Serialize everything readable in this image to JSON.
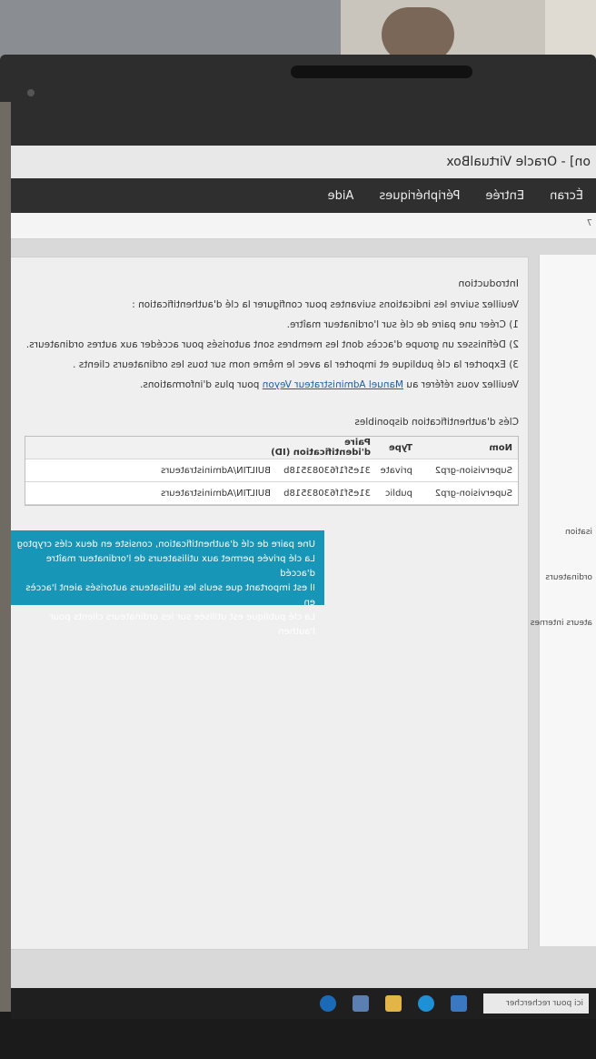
{
  "window": {
    "title": "on] - Oracle VirtualBox",
    "menu": [
      "Écran",
      "Entrée",
      "Périphériques",
      "Aide"
    ],
    "version": "7"
  },
  "sidebar": {
    "items": [
      "isation",
      "ordinateurs",
      "ateurs internes"
    ]
  },
  "content": {
    "intro_title": "Introduction",
    "intro_text": "Veuillez suivre les indications suivantes pour configurer la clé d'authentification :",
    "steps": [
      "1) Créer une paire de clé sur l'ordinateur maître.",
      "2) Définissez un groupe d'accès dont les membres sont autorisés pour accéder aux autres ordinateurs.",
      "3) Exporter la clé publique et importer la avec le même nom sur tous les ordinateurs clients ."
    ],
    "help_prefix": "Veuillez vous référer au ",
    "help_link": "Manuel Administrateur Veyon",
    "help_suffix": " pour plus d'informations.",
    "keys_title": "Clés d'authentification disponibles",
    "table": {
      "headers": [
        "Nom",
        "Type",
        "Paire d'identification (ID)",
        ""
      ],
      "rows": [
        [
          "Supervision-grp2",
          "private",
          "31e5f1f63083518b",
          "BUILTIN/Administrateurs"
        ],
        [
          "Supervision-grp2",
          "public",
          "31e5f1f63083518b",
          "BUILTIN/Administrateurs"
        ]
      ]
    },
    "tooltip": [
      "Une paire de clé d'authentification, consiste en deux clés cryptog",
      "La clé privée permet aux utilisateurs de l'ordinateur maître d'accéd",
      "Il est important que seuls les utilisateurs autorisés aient l'accès en",
      "La clé publique est utilisée sur les ordinateurs clients pour l'authen"
    ]
  },
  "taskbar": {
    "search": "ici pour rechercher"
  }
}
